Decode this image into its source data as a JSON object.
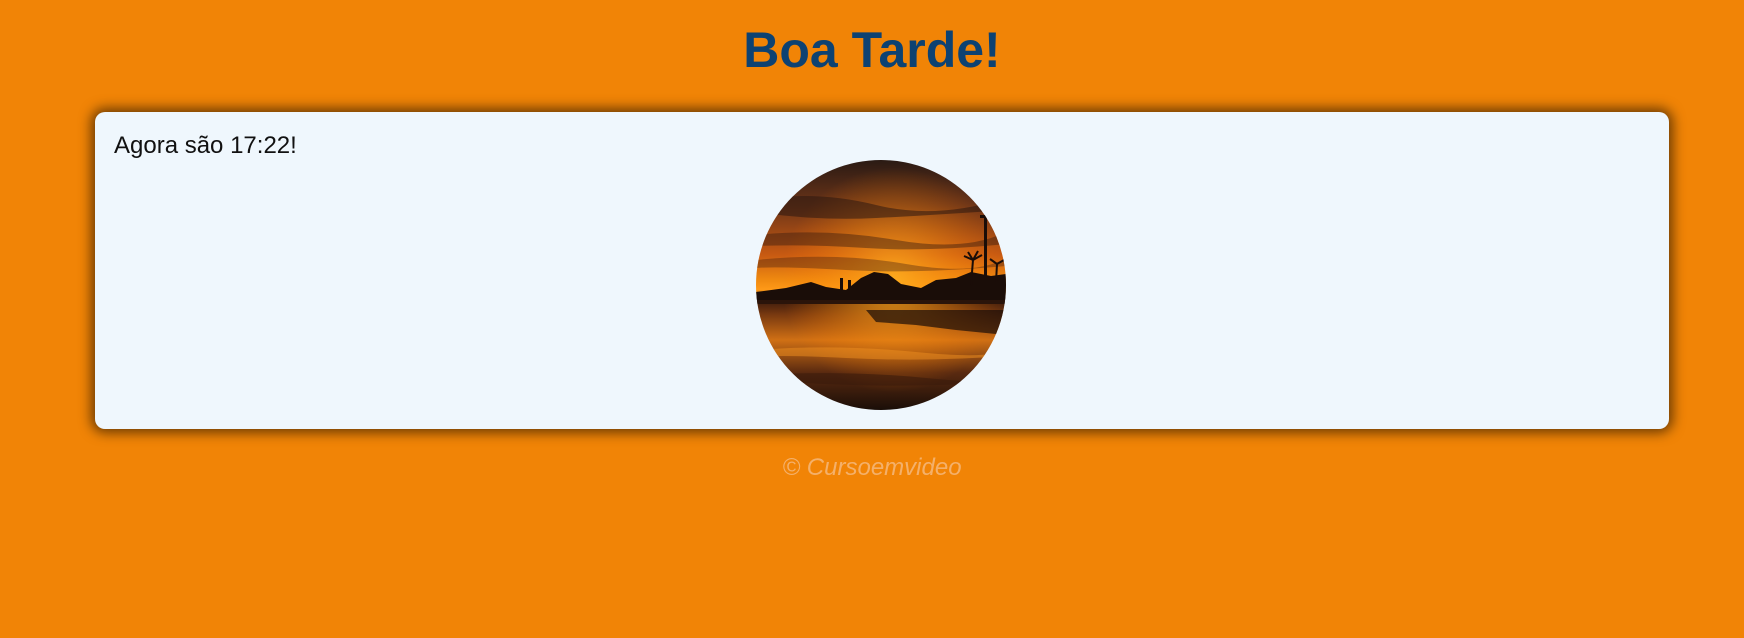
{
  "header": {
    "greeting": "Boa Tarde!"
  },
  "card": {
    "time_message": "Agora são 17:22!",
    "image": {
      "icon": "sunset-beach-photo"
    }
  },
  "footer": {
    "text": "© Cursoemvideo"
  },
  "colors": {
    "background": "#f18406",
    "title": "#0d4272",
    "card": "#eff7fd",
    "footer_text": "#f4b06a"
  }
}
